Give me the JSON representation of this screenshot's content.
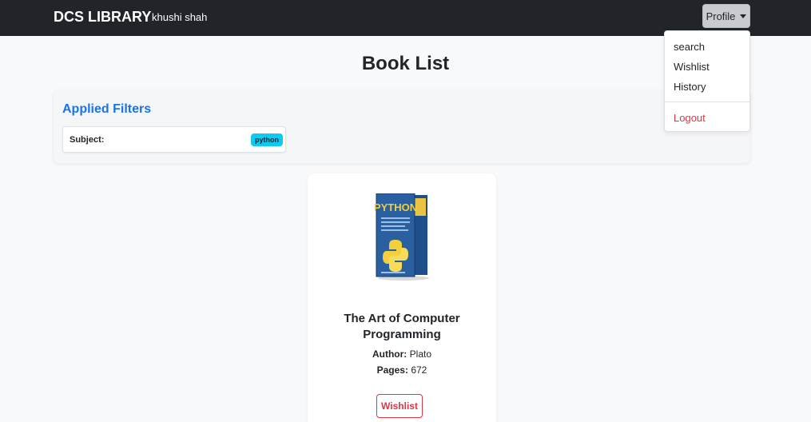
{
  "navbar": {
    "brand": "DCS LIBRARY",
    "user_name": "khushi shah",
    "profile_label": "Profile"
  },
  "dropdown": {
    "items": [
      {
        "label": "search"
      },
      {
        "label": "Wishlist"
      },
      {
        "label": "History"
      }
    ],
    "logout_label": "Logout"
  },
  "page": {
    "title": "Book List"
  },
  "filters": {
    "title": "Applied Filters",
    "subject_label": "Subject:",
    "subject_value": "python"
  },
  "book": {
    "cover_text": "PYTHON",
    "title": "The Art of Computer Programming",
    "author_label": "Author:",
    "author": "Plato",
    "pages_label": "Pages:",
    "pages": "672",
    "wishlist_label": "Wishlist"
  },
  "colors": {
    "navbar_bg": "#212529",
    "accent_blue": "#1a73e8",
    "badge_cyan": "#0dcaf0",
    "danger_red": "#dc3545"
  }
}
